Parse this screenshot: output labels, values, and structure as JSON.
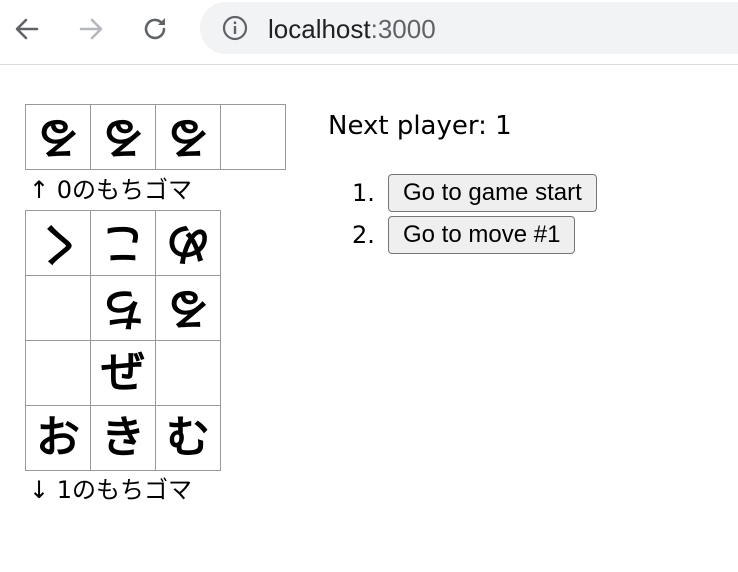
{
  "browser": {
    "url_host": "localhost",
    "url_port": ":3000",
    "icons": {
      "back": "back-arrow-icon",
      "forward": "forward-arrow-icon",
      "reload": "reload-icon",
      "site_info": "info-icon"
    }
  },
  "game": {
    "top_hand": {
      "pieces": [
        "る",
        "る",
        "る",
        ""
      ],
      "label": "↑ 0のもちゴマ"
    },
    "board": [
      [
        {
          "ch": "く",
          "flipped": true
        },
        {
          "ch": "こ",
          "flipped": true
        },
        {
          "ch": "め",
          "flipped": true
        }
      ],
      [
        {
          "ch": "",
          "flipped": false
        },
        {
          "ch": "ち",
          "flipped": true
        },
        {
          "ch": "る",
          "flipped": true
        }
      ],
      [
        {
          "ch": "",
          "flipped": false
        },
        {
          "ch": "ぜ",
          "flipped": false
        },
        {
          "ch": "",
          "flipped": false
        }
      ],
      [
        {
          "ch": "お",
          "flipped": false
        },
        {
          "ch": "き",
          "flipped": false
        },
        {
          "ch": "む",
          "flipped": false
        }
      ]
    ],
    "bottom_hand": {
      "label": "↓ 1のもちゴマ"
    },
    "status": "Next player: 1",
    "moves": [
      {
        "num": "1.",
        "label": "Go to game start"
      },
      {
        "num": "2.",
        "label": "Go to move #1"
      }
    ]
  }
}
